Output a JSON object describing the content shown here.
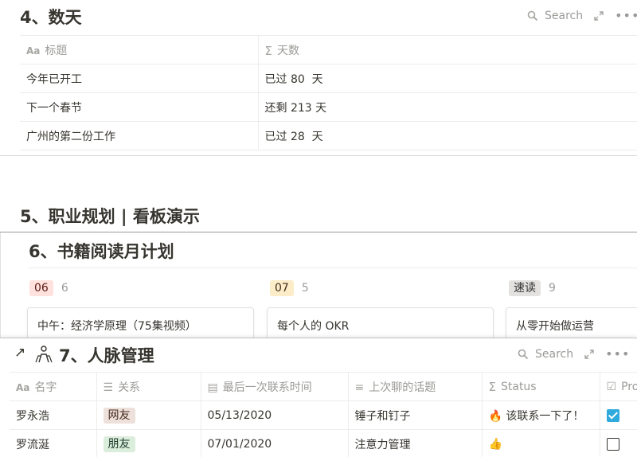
{
  "days_db": {
    "title": "4、数天",
    "search_label": "Search",
    "columns": [
      "标题",
      "天数"
    ],
    "rows": [
      {
        "title": "今年已开工",
        "days": "已过 80  天"
      },
      {
        "title": "下一个春节",
        "days": "还剩 213 天"
      },
      {
        "title": "广州的第二份工作",
        "days": "已过 28  天"
      }
    ]
  },
  "career": {
    "title": "5、职业规划 | 看板演示"
  },
  "reading": {
    "title": "6、书籍阅读月计划",
    "groups": [
      {
        "tag": "06",
        "count": "6",
        "card": "中午：经济学原理（75集视频）"
      },
      {
        "tag": "07",
        "count": "5",
        "card": "每个人的 OKR"
      },
      {
        "tag": "速读",
        "count": "9",
        "card": "从零开始做运营"
      }
    ]
  },
  "contacts": {
    "arrow": "↗",
    "title": "7、人脉管理",
    "search_label": "Search",
    "columns": [
      "名字",
      "关系",
      "最后一次联系时间",
      "上次聊的话题",
      "Status",
      "Pro"
    ],
    "rows": [
      {
        "name": "罗永浩",
        "relation": "网友",
        "date": "05/13/2020",
        "topic": "锤子和钉子",
        "status_emoji": "🔥",
        "status": "该联系一下了！",
        "checked": true
      },
      {
        "name": "罗流涎",
        "relation": "朋友",
        "date": "07/01/2020",
        "topic": "注意力管理",
        "status_emoji": "👍",
        "status": "",
        "checked": false
      }
    ]
  }
}
